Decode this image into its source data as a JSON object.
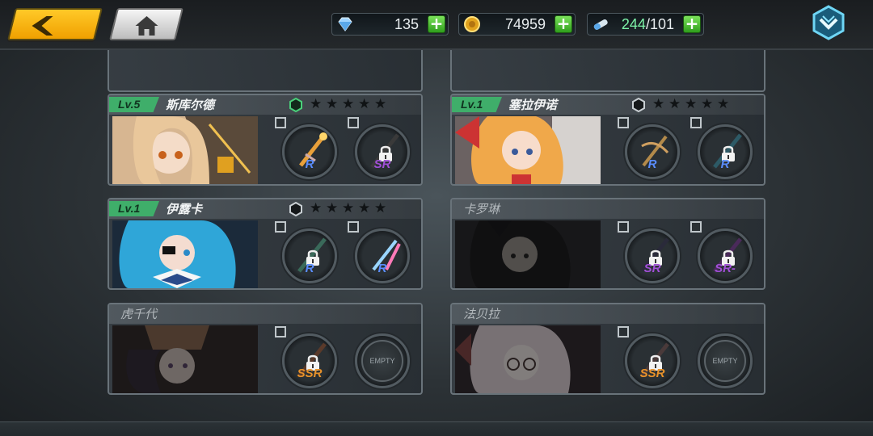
{
  "topbar": {
    "diamonds": "135",
    "gold": "74959",
    "stamina_current": "244",
    "stamina_max": "/101",
    "plus_label": "+"
  },
  "icons": {
    "back": "back-arrow-icon",
    "home": "home-icon",
    "diamond": "diamond-icon",
    "gold": "gold-coin-icon",
    "stamina": "stamina-icon",
    "menu": "chevron-down-menu-icon",
    "lock": "lock-icon"
  },
  "colors": {
    "level_badge": "#3fae6a",
    "rank_r": "#5a8dff",
    "rank_sr": "#a04fd6",
    "rank_ssr": "#e8922a",
    "accent_yellow": "#f0a000"
  },
  "characters": [
    {
      "level": "Lv.5",
      "name": "斯库尔德",
      "unlocked": true,
      "stars": 5,
      "slots": [
        {
          "rank": "R",
          "locked": false
        },
        {
          "rank": "SR",
          "locked": true
        }
      ]
    },
    {
      "level": "Lv.1",
      "name": "塞拉伊诺",
      "unlocked": true,
      "stars": 5,
      "slots": [
        {
          "rank": "R",
          "locked": false
        },
        {
          "rank": "R",
          "locked": true
        }
      ]
    },
    {
      "level": "Lv.1",
      "name": "伊露卡",
      "unlocked": true,
      "stars": 5,
      "slots": [
        {
          "rank": "R",
          "locked": true
        },
        {
          "rank": "R",
          "locked": false
        }
      ]
    },
    {
      "name": "卡罗琳",
      "unlocked": false,
      "slots": [
        {
          "rank": "SR",
          "locked": true
        },
        {
          "rank": "SR-",
          "locked": true
        }
      ]
    },
    {
      "name": "虎千代",
      "unlocked": false,
      "slots": [
        {
          "rank": "SSR",
          "locked": true
        },
        {
          "rank": "EMPTY",
          "locked": false
        }
      ]
    },
    {
      "name": "法贝拉",
      "unlocked": false,
      "slots": [
        {
          "rank": "SSR",
          "locked": true
        },
        {
          "rank": "EMPTY",
          "locked": false
        }
      ]
    }
  ]
}
